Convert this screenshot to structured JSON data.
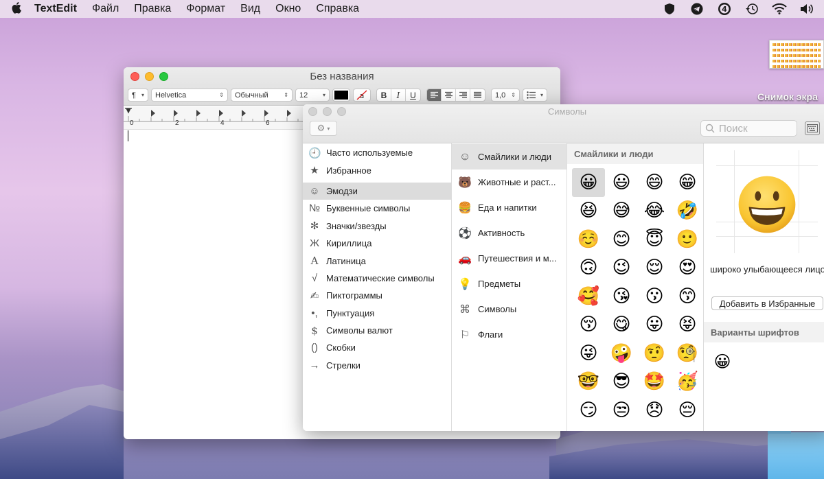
{
  "menubar": {
    "app": "TextEdit",
    "menus": [
      "Файл",
      "Правка",
      "Формат",
      "Вид",
      "Окно",
      "Справка"
    ],
    "status_icons": [
      "shield-icon",
      "telegram-icon",
      "onepassword-icon",
      "time-machine-icon",
      "wifi-icon",
      "volume-icon"
    ]
  },
  "desktop": {
    "screenshot_label": "Снимок экра"
  },
  "textedit": {
    "title": "Без названия",
    "toolbar": {
      "paragraph": "¶",
      "font": "Helvetica",
      "style": "Обычный",
      "size": "12",
      "bold": "B",
      "italic": "I",
      "underline": "U",
      "line_spacing": "1,0"
    },
    "ruler": [
      "0",
      "2",
      "4",
      "6"
    ]
  },
  "characters": {
    "title": "Символы",
    "search_placeholder": "Поиск",
    "categories": [
      {
        "icon": "clock-icon",
        "glyph": "🕘",
        "label": "Часто используемые"
      },
      {
        "icon": "star-icon",
        "glyph": "★",
        "label": "Избранное"
      },
      {
        "icon": "smiley-icon",
        "glyph": "☺",
        "label": "Эмодзи"
      },
      {
        "icon": "numero-icon",
        "glyph": "№",
        "label": "Буквенные символы"
      },
      {
        "icon": "asterisk-icon",
        "glyph": "✻",
        "label": "Значки/звезды"
      },
      {
        "icon": "cyrillic-icon",
        "glyph": "Ж",
        "label": "Кириллица"
      },
      {
        "icon": "latin-icon",
        "glyph": "A",
        "label": "Латиница"
      },
      {
        "icon": "sqrt-icon",
        "glyph": "√",
        "label": "Математические символы"
      },
      {
        "icon": "pictogram-icon",
        "glyph": "✍",
        "label": "Пиктограммы"
      },
      {
        "icon": "punctuation-icon",
        "glyph": "•,",
        "label": "Пунктуация"
      },
      {
        "icon": "dollar-icon",
        "glyph": "$",
        "label": "Символы валют"
      },
      {
        "icon": "parentheses-icon",
        "glyph": "()",
        "label": "Скобки"
      },
      {
        "icon": "arrow-icon",
        "glyph": "→",
        "label": "Стрелки"
      }
    ],
    "subcategories": [
      {
        "icon": "smiley-icon",
        "glyph": "☺",
        "label": "Смайлики и люди"
      },
      {
        "icon": "animal-icon",
        "glyph": "🐻",
        "label": "Животные и раст..."
      },
      {
        "icon": "food-icon",
        "glyph": "🍔",
        "label": "Еда и напитки"
      },
      {
        "icon": "ball-icon",
        "glyph": "⚽",
        "label": "Активность"
      },
      {
        "icon": "car-icon",
        "glyph": "🚗",
        "label": "Путешествия и м..."
      },
      {
        "icon": "bulb-icon",
        "glyph": "💡",
        "label": "Предметы"
      },
      {
        "icon": "symbols-icon",
        "glyph": "⌘",
        "label": "Символы"
      },
      {
        "icon": "flag-icon",
        "glyph": "⚐",
        "label": "Флаги"
      }
    ],
    "section_title": "Смайлики и люди",
    "emojis": [
      "😀",
      "😃",
      "😄",
      "😁",
      "😆",
      "😅",
      "😂",
      "🤣",
      "☺️",
      "😊",
      "😇",
      "🙂",
      "🙃",
      "😉",
      "😌",
      "😍",
      "🥰",
      "😘",
      "😗",
      "😙",
      "😚",
      "😋",
      "😛",
      "😝",
      "😜",
      "🤪",
      "🤨",
      "🧐",
      "🤓",
      "😎",
      "🤩",
      "🥳",
      "😏",
      "😒",
      "😞",
      "😔"
    ],
    "selected_name": "широко улыбающееся лицо",
    "add_favorite": "Добавить в Избранные",
    "font_variants_title": "Варианты шрифтов"
  }
}
